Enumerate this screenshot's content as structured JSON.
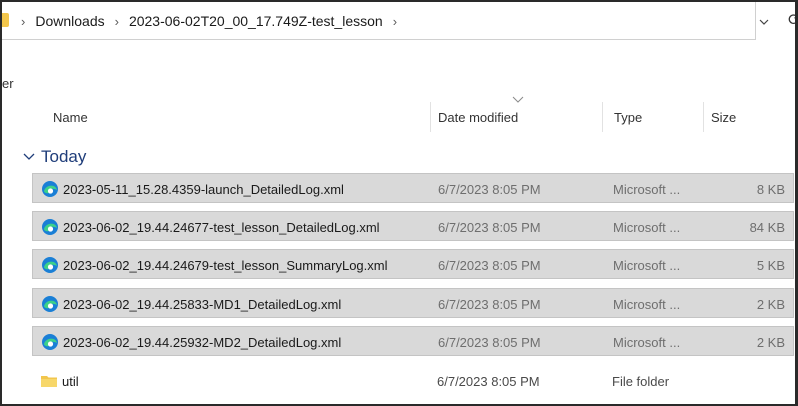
{
  "breadcrumb": {
    "items": [
      "Downloads",
      "2023-06-02T20_00_17.749Z-test_lesson"
    ]
  },
  "toolbar": {
    "partial_label": "er"
  },
  "columns": {
    "name": "Name",
    "date": "Date modified",
    "type": "Type",
    "size": "Size"
  },
  "group": {
    "label": "Today"
  },
  "rows": [
    {
      "name": "2023-05-11_15.28.4359-launch_DetailedLog.xml",
      "date": "6/7/2023 8:05 PM",
      "type": "Microsoft ...",
      "size": "8 KB",
      "icon": "edge-icon"
    },
    {
      "name": "2023-06-02_19.44.24677-test_lesson_DetailedLog.xml",
      "date": "6/7/2023 8:05 PM",
      "type": "Microsoft ...",
      "size": "84 KB",
      "icon": "edge-icon"
    },
    {
      "name": "2023-06-02_19.44.24679-test_lesson_SummaryLog.xml",
      "date": "6/7/2023 8:05 PM",
      "type": "Microsoft ...",
      "size": "5 KB",
      "icon": "edge-icon"
    },
    {
      "name": "2023-06-02_19.44.25833-MD1_DetailedLog.xml",
      "date": "6/7/2023 8:05 PM",
      "type": "Microsoft ...",
      "size": "2 KB",
      "icon": "edge-icon"
    },
    {
      "name": "2023-06-02_19.44.25932-MD2_DetailedLog.xml",
      "date": "6/7/2023 8:05 PM",
      "type": "Microsoft ...",
      "size": "2 KB",
      "icon": "edge-icon"
    },
    {
      "name": "util",
      "date": "6/7/2023 8:05 PM",
      "type": "File folder",
      "size": "",
      "icon": "folder-icon"
    }
  ],
  "colors": {
    "selection": "#d9d9d9",
    "group_text": "#1f3d7a",
    "folder": "#f2c64c"
  }
}
